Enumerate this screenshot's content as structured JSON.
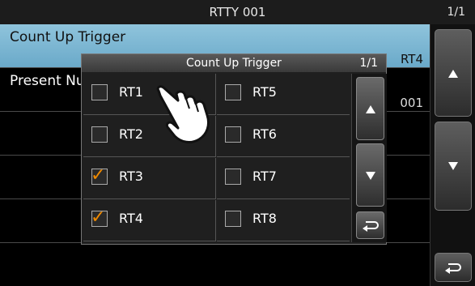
{
  "header": {
    "title": "RTTY 001",
    "page": "1/1"
  },
  "list": [
    {
      "label": "Count Up Trigger",
      "value": "RT4"
    },
    {
      "label": "Present Number",
      "value": "001"
    }
  ],
  "side": {
    "up_icon": "triangle-up-icon",
    "down_icon": "triangle-down-icon",
    "back_icon": "return-arrow-icon"
  },
  "dialog": {
    "title": "Count Up Trigger",
    "page": "1/1",
    "options": [
      {
        "label": "RT1",
        "checked": false
      },
      {
        "label": "RT2",
        "checked": false
      },
      {
        "label": "RT3",
        "checked": true
      },
      {
        "label": "RT4",
        "checked": true
      },
      {
        "label": "RT5",
        "checked": false
      },
      {
        "label": "RT6",
        "checked": false
      },
      {
        "label": "RT7",
        "checked": false
      },
      {
        "label": "RT8",
        "checked": false
      }
    ],
    "check_glyph": "✓",
    "check_color": "#f08a00"
  },
  "colors": {
    "selected_row": "#7bb6d4",
    "check": "#f08a00"
  }
}
